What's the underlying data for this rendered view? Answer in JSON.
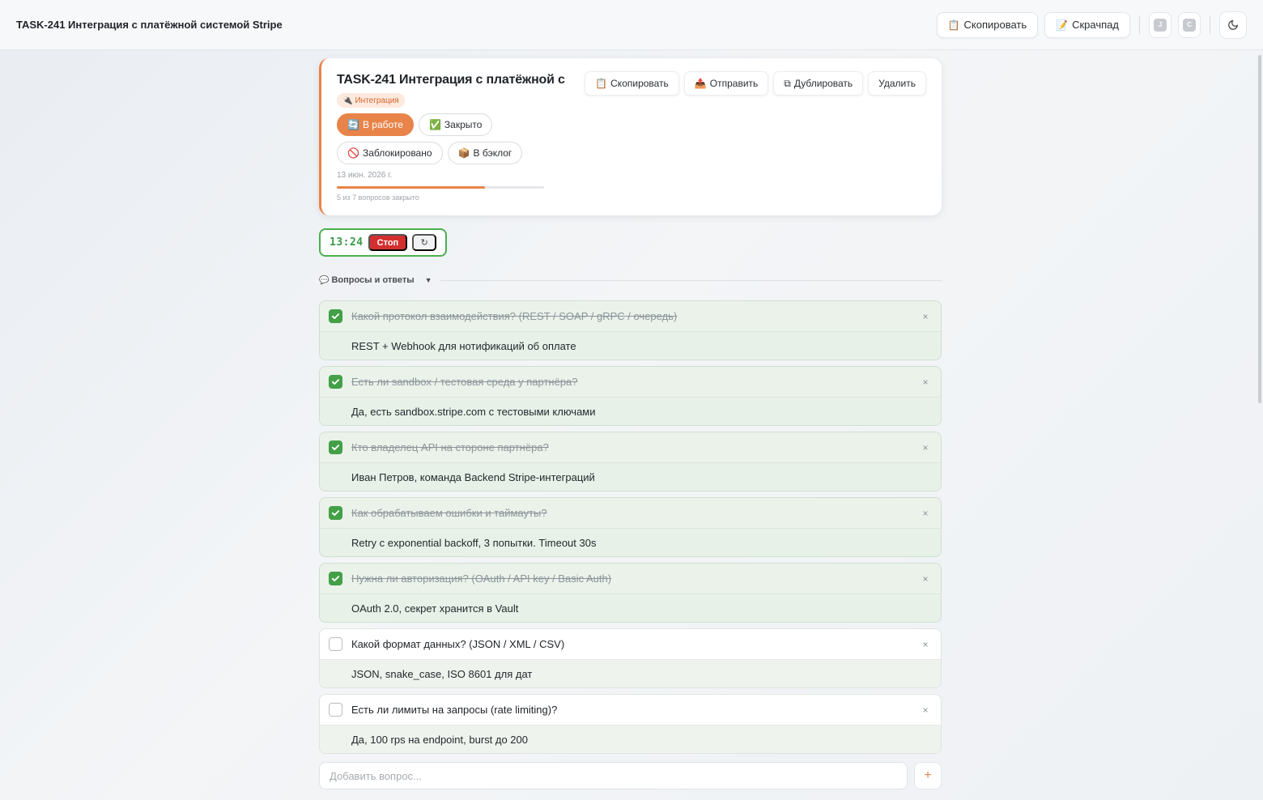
{
  "topbar": {
    "title": "TASK-241 Интеграция с платёжной системой Stripe",
    "copy_label": "Скопировать",
    "scratchpad_label": "Скрачпад",
    "avatars": [
      "J",
      "C"
    ]
  },
  "task": {
    "title": "TASK-241 Интеграция с платёжной системой Stripe",
    "actions": {
      "copy": "Скопировать",
      "send": "Отправить",
      "duplicate": "Дублировать",
      "delete": "Удалить"
    },
    "tag": "Интеграция",
    "statuses": {
      "in_progress": "В работе",
      "closed": "Закрыто",
      "blocked": "Заблокировано",
      "backlog": "В бэклог"
    },
    "active_status": "in_progress",
    "date": "13 июн. 2026 г.",
    "progress_fraction": 0.714,
    "progress_text": "5 из 7 вопросов закрыто"
  },
  "timer": {
    "time": "13:24",
    "stop_label": "Стоп"
  },
  "qa": {
    "section_title": "Вопросы и ответы",
    "items": [
      {
        "question": "Какой протокол взаимодействия? (REST / SOAP / gRPC / очередь)",
        "answer": "REST + Webhook для нотификаций об оплате",
        "done": true
      },
      {
        "question": "Есть ли sandbox / тестовая среда у партнёра?",
        "answer": "Да, есть sandbox.stripe.com с тестовыми ключами",
        "done": true
      },
      {
        "question": "Кто владелец API на стороне партнёра?",
        "answer": "Иван Петров, команда Backend Stripe-интеграций",
        "done": true
      },
      {
        "question": "Как обрабатываем ошибки и таймауты?",
        "answer": "Retry с exponential backoff, 3 попытки. Timeout 30s",
        "done": true
      },
      {
        "question": "Нужна ли авторизация? (OAuth / API key / Basic Auth)",
        "answer": "OAuth 2.0, секрет хранится в Vault",
        "done": true
      },
      {
        "question": "Какой формат данных? (JSON / XML / CSV)",
        "answer": "JSON, snake_case, ISO 8601 для дат",
        "done": false
      },
      {
        "question": "Есть ли лимиты на запросы (rate limiting)?",
        "answer": "Да, 100 rps на endpoint, burst до 200",
        "done": false
      }
    ],
    "add_placeholder": "Добавить вопрос..."
  }
}
